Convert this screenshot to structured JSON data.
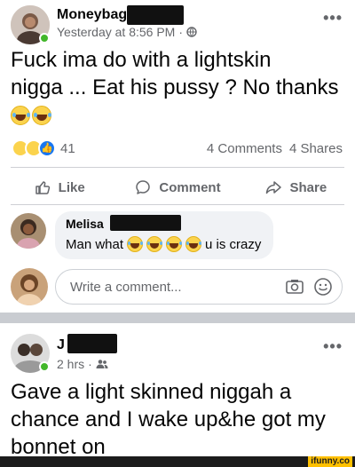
{
  "post1": {
    "author_name": "Moneybag",
    "timestamp": "Yesterday at 8:56 PM",
    "meta_separator": "·",
    "privacy_icon": "globe-icon",
    "more_icon": "•••",
    "text_line1": "Fuck ima do with a lightskin",
    "text_line2": "nigga ... Eat his pussy ? No thanks",
    "reaction_count": "41",
    "comments_count": "4 Comments",
    "shares_count": "4 Shares",
    "like_label": "Like",
    "comment_label": "Comment",
    "share_label": "Share",
    "comment": {
      "author": "Melisa",
      "text_before": "Man what",
      "text_after": "u is crazy"
    },
    "write_placeholder": "Write a comment..."
  },
  "post2": {
    "author_name": "J",
    "timestamp": "2 hrs",
    "meta_separator": "·",
    "privacy_icon": "friends-icon",
    "more_icon": "•••",
    "text_line1": "Gave a light skinned niggah a",
    "text_line2": "chance and I wake up&he got my",
    "text_line3": "bonnet on"
  },
  "watermark": "ifunny.co",
  "colors": {
    "facebook_blue": "#1877f2",
    "online_green": "#42b72a",
    "secondary_text": "#65676b",
    "separator": "#c9ccd1"
  }
}
